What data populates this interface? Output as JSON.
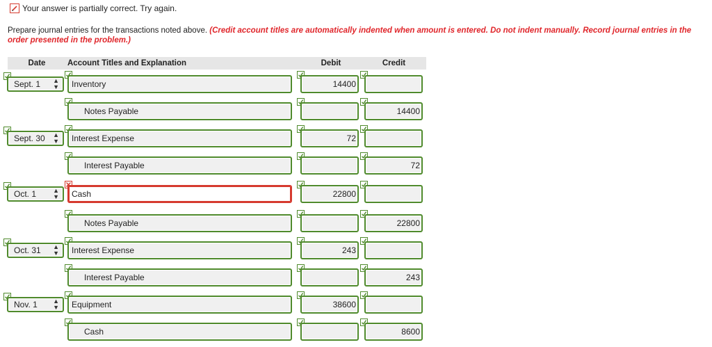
{
  "status": {
    "text": "Your answer is partially correct.  Try again."
  },
  "instructions": {
    "plain": "Prepare journal entries for the transactions noted above. ",
    "emphasis": "(Credit account titles are automatically indented when amount is entered. Do not indent manually. Record journal entries in the order presented in the problem.)"
  },
  "table": {
    "headers": {
      "date": "Date",
      "account": "Account Titles and Explanation",
      "debit": "Debit",
      "credit": "Credit"
    },
    "rows": [
      {
        "date": "Sept. 1",
        "account": "Inventory",
        "debit": "14400",
        "credit": "",
        "indent": false,
        "correct": true
      },
      {
        "date": "",
        "account": "Notes Payable",
        "debit": "",
        "credit": "14400",
        "indent": true,
        "correct": true
      },
      {
        "date": "Sept. 30",
        "account": "Interest Expense",
        "debit": "72",
        "credit": "",
        "indent": false,
        "correct": true
      },
      {
        "date": "",
        "account": "Interest Payable",
        "debit": "",
        "credit": "72",
        "indent": true,
        "correct": true
      },
      {
        "date": "Oct. 1",
        "account": "Cash",
        "debit": "22800",
        "credit": "",
        "indent": false,
        "correct": false
      },
      {
        "date": "",
        "account": "Notes Payable",
        "debit": "",
        "credit": "22800",
        "indent": true,
        "correct": true
      },
      {
        "date": "Oct. 31",
        "account": "Interest Expense",
        "debit": "243",
        "credit": "",
        "indent": false,
        "correct": true
      },
      {
        "date": "",
        "account": "Interest Payable",
        "debit": "",
        "credit": "243",
        "indent": true,
        "correct": true
      },
      {
        "date": "Nov. 1",
        "account": "Equipment",
        "debit": "38600",
        "credit": "",
        "indent": false,
        "correct": true
      },
      {
        "date": "",
        "account": "Cash",
        "debit": "",
        "credit": "8600",
        "indent": true,
        "correct": true
      }
    ]
  },
  "colors": {
    "correct_border": "#4f8a2c",
    "incorrect_border": "#d63a2f",
    "instruction_red": "#e0262b",
    "header_bg": "#e6e6e6"
  },
  "icons": {
    "status": "pencil-icon",
    "correct": "checkmark-icon",
    "incorrect": "x-icon",
    "date_select": "updown-arrows-icon"
  }
}
